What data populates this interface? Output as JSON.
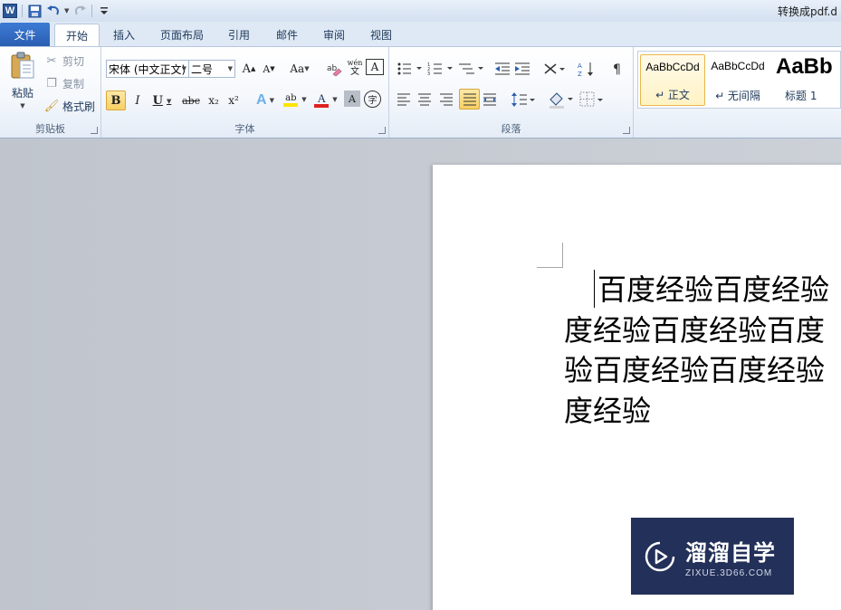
{
  "titlebar": {
    "window_title": "转换成pdf.d"
  },
  "qat": {
    "word_icon": "W",
    "icons": [
      "word-icon",
      "save-icon",
      "undo-icon",
      "redo-icon",
      "customize-icon"
    ]
  },
  "tabs": [
    {
      "label": "文件",
      "name": "tab-file"
    },
    {
      "label": "开始",
      "name": "tab-home"
    },
    {
      "label": "插入",
      "name": "tab-insert"
    },
    {
      "label": "页面布局",
      "name": "tab-page-layout"
    },
    {
      "label": "引用",
      "name": "tab-references"
    },
    {
      "label": "邮件",
      "name": "tab-mailings"
    },
    {
      "label": "审阅",
      "name": "tab-review"
    },
    {
      "label": "视图",
      "name": "tab-view"
    }
  ],
  "clipboard": {
    "group": "剪贴板",
    "paste": "粘贴",
    "cut": "剪切",
    "copy": "复制",
    "format_painter": "格式刷"
  },
  "font": {
    "group": "字体",
    "font_name": "宋体 (中文正文)",
    "font_size": "二号",
    "bold": "B",
    "italic": "I",
    "underline": "U",
    "strike": "abc",
    "subscript": "x₂",
    "superscript": "x²",
    "grow": "A",
    "shrink": "A",
    "case": "Aa",
    "clear": "A",
    "phonetic": "wén",
    "phonetic_char": "文",
    "border_char": "A",
    "highlight": "ab",
    "color": "A",
    "shade": "A",
    "enclose": "字"
  },
  "paragraph": {
    "group": "段落"
  },
  "styles": [
    {
      "sample": "AaBbCcDd",
      "label": "↵ 正文",
      "selected": true
    },
    {
      "sample": "AaBbCcDd",
      "label": "↵ 无间隔",
      "selected": false
    },
    {
      "sample": "AaBb",
      "label": "标题 1",
      "selected": false
    }
  ],
  "document": {
    "lines": [
      "百度经验百度经验",
      "度经验百度经验百度",
      "验百度经验百度经验",
      "度经验"
    ]
  },
  "watermark": {
    "main": "溜溜自学",
    "sub": "ZIXUE.3D66.COM"
  },
  "colors": {
    "accent": "#2a5eb2",
    "watermark_bg": "#233059",
    "font_color_bar": "#e02020",
    "highlight_bar": "#ffe400"
  }
}
